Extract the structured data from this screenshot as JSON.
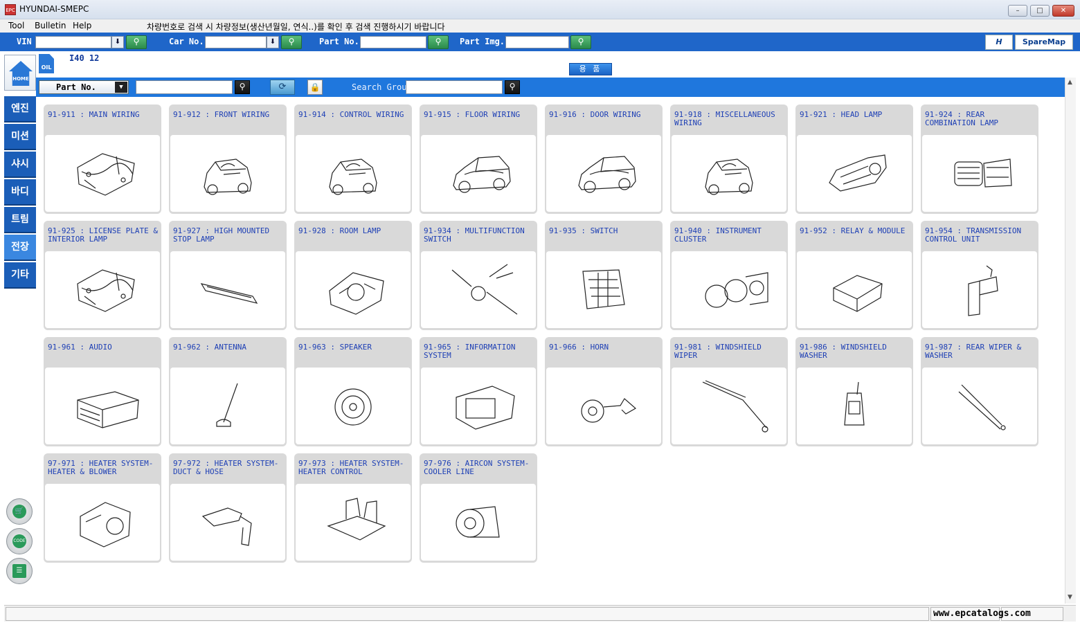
{
  "window": {
    "title": "HYUNDAI-SMEPC",
    "icon_label": "EPC"
  },
  "menu": {
    "items": [
      {
        "label": "Tool"
      },
      {
        "label": "Bulletin"
      },
      {
        "label": "Help"
      }
    ],
    "notice": "차량번호로 검색 시 차량정보(생산년월일, 연식..)를 확인 후 검색 진행하시기 바랍니다"
  },
  "toolbar": {
    "vin_label": "VIN",
    "car_no_label": "Car No.",
    "part_no_label": "Part No.",
    "part_img_label": "Part Img.",
    "hyundai_logo": "H",
    "sparemap_logo": "SpareMap"
  },
  "sidebar": {
    "home_label": "HOME",
    "items": [
      {
        "label": "엔진"
      },
      {
        "label": "미션"
      },
      {
        "label": "샤시"
      },
      {
        "label": "바디"
      },
      {
        "label": "트림"
      },
      {
        "label": "전장"
      },
      {
        "label": "기타"
      }
    ],
    "active": "전장",
    "tools": [
      {
        "icon": "cart-icon"
      },
      {
        "icon": "code-icon",
        "text": "CODE"
      },
      {
        "icon": "notebook-icon"
      }
    ]
  },
  "header": {
    "oil_badge": "OIL",
    "model_code": "I40 12",
    "accessories_button": "용 품"
  },
  "search": {
    "mode_select": "Part No.",
    "search_group_label": "Search Group"
  },
  "cards": [
    {
      "title": "91-911 : MAIN WIRING",
      "icon": "wiring-harness-icon"
    },
    {
      "title": "91-912 : FRONT WIRING",
      "icon": "car-front-icon"
    },
    {
      "title": "91-914 : CONTROL WIRING",
      "icon": "car-front-icon"
    },
    {
      "title": "91-915 : FLOOR WIRING",
      "icon": "car-side-icon"
    },
    {
      "title": "91-916 : DOOR WIRING",
      "icon": "car-side-icon"
    },
    {
      "title": "91-918 : MISCELLANEOUS WIRING",
      "icon": "car-front-icon"
    },
    {
      "title": "91-921 : HEAD LAMP",
      "icon": "head-lamp-icon"
    },
    {
      "title": "91-924 : REAR COMBINATION LAMP",
      "icon": "rear-lamp-icon"
    },
    {
      "title": "91-925 : LICENSE PLATE & INTERIOR LAMP",
      "icon": "wiring-harness-icon"
    },
    {
      "title": "91-927 : HIGH MOUNTED STOP LAMP",
      "icon": "stop-lamp-icon"
    },
    {
      "title": "91-928 : ROOM LAMP",
      "icon": "room-lamp-icon"
    },
    {
      "title": "91-934 : MULTIFUNCTION SWITCH",
      "icon": "multifunction-switch-icon"
    },
    {
      "title": "91-935 : SWITCH",
      "icon": "switch-panel-icon"
    },
    {
      "title": "91-940 : INSTRUMENT CLUSTER",
      "icon": "instrument-cluster-icon"
    },
    {
      "title": "91-952 : RELAY & MODULE",
      "icon": "relay-module-icon"
    },
    {
      "title": "91-954 : TRANSMISSION CONTROL UNIT",
      "icon": "control-unit-icon"
    },
    {
      "title": "91-961 : AUDIO",
      "icon": "audio-unit-icon"
    },
    {
      "title": "91-962 : ANTENNA",
      "icon": "antenna-icon"
    },
    {
      "title": "91-963 : SPEAKER",
      "icon": "speaker-icon"
    },
    {
      "title": "91-965 : INFORMATION SYSTEM",
      "icon": "navigation-unit-icon"
    },
    {
      "title": "91-966 : HORN",
      "icon": "horn-icon"
    },
    {
      "title": "91-981 : WINDSHIELD WIPER",
      "icon": "wiper-icon"
    },
    {
      "title": "91-986 : WINDSHIELD WASHER",
      "icon": "washer-reservoir-icon"
    },
    {
      "title": "91-987 : REAR WIPER & WASHER",
      "icon": "rear-wiper-icon"
    },
    {
      "title": "97-971 : HEATER SYSTEM-HEATER & BLOWER",
      "icon": "heater-blower-icon"
    },
    {
      "title": "97-972 : HEATER SYSTEM-DUCT & HOSE",
      "icon": "duct-hose-icon"
    },
    {
      "title": "97-973 : HEATER SYSTEM-HEATER CONTROL",
      "icon": "heater-control-icon"
    },
    {
      "title": "97-976 : AIRCON SYSTEM-COOLER LINE",
      "icon": "compressor-icon"
    }
  ],
  "status": {
    "watermark": "www.epcatalogs.com"
  },
  "colors": {
    "toolbar_blue": "#1f66c9",
    "search_blue": "#1f77dd",
    "card_title": "#1d3fb5",
    "card_bg": "#d9d9d9"
  }
}
